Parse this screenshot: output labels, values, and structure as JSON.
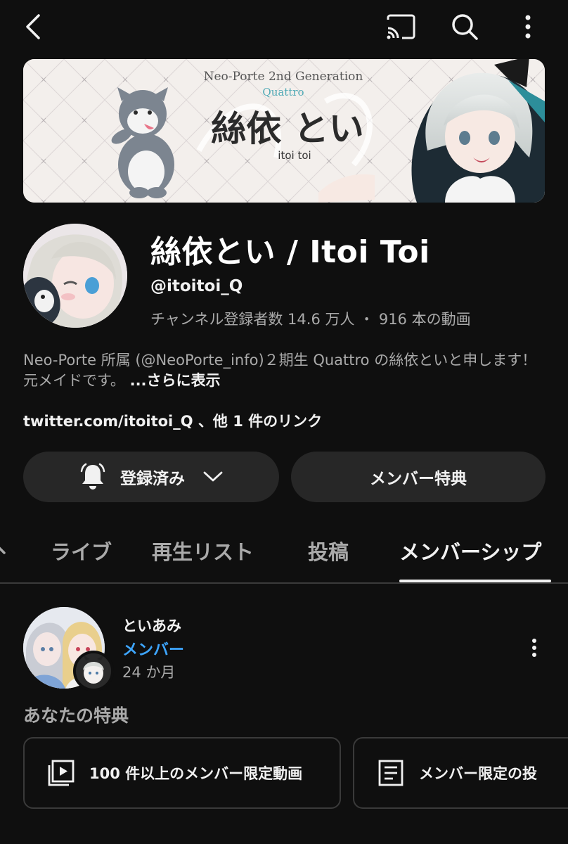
{
  "channel": {
    "name": "絲依とい / Itoi Toi",
    "handle": "@itoitoi_Q",
    "stats": "チャンネル登録者数 14.6 万人 ・ 916 本の動画",
    "description": "Neo-Porte 所属 (@NeoPorte_info)２期生 Quattro の絲依といと申します！元メイドです。",
    "more": "...さらに表示",
    "links": "twitter.com/itoitoi_Q 、他 1 件のリンク",
    "banner": {
      "headline": "Neo-Porte  2nd Generation",
      "unit": "Quattro",
      "title": "絲依 とい",
      "romaji": "itoi toi"
    }
  },
  "buttons": {
    "subscribed": "登録済み",
    "membership_perks": "メンバー特典"
  },
  "tabs": [
    {
      "label": "ライブ"
    },
    {
      "label": "再生リスト"
    },
    {
      "label": "投稿"
    },
    {
      "label": "メンバーシップ",
      "active": true
    }
  ],
  "membership": {
    "name": "といあみ",
    "level": "メンバー",
    "duration": "24 か月",
    "perks_title": "あなたの特典",
    "perks": [
      {
        "label": "100 件以上のメンバー限定動画",
        "icon": "video-library-icon"
      },
      {
        "label": "メンバー限定の投",
        "icon": "post-icon"
      }
    ]
  },
  "colors": {
    "background": "#0f0f0f",
    "surface": "#272727",
    "accent_blue": "#3ea6ff",
    "secondary_text": "#aaaaaa"
  }
}
